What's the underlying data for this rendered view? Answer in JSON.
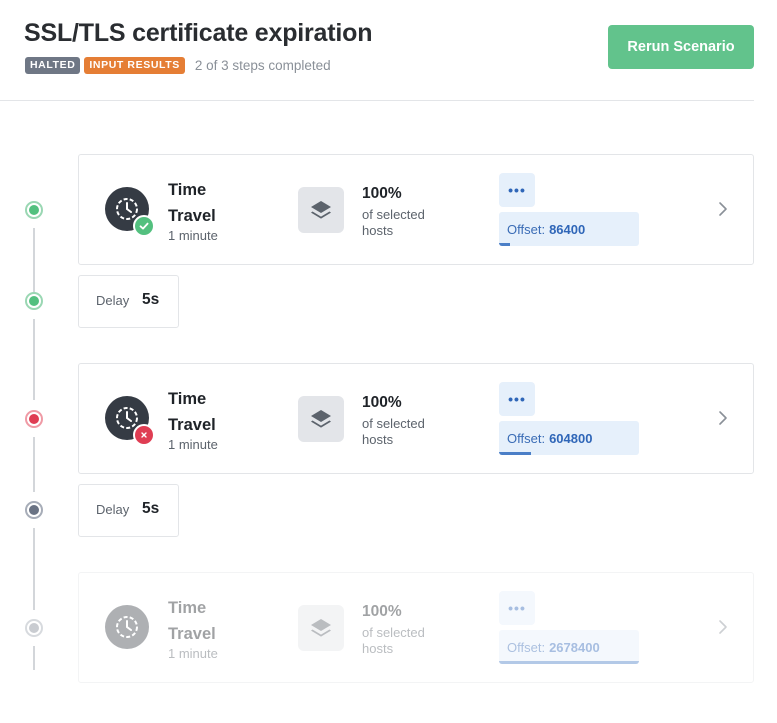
{
  "header": {
    "title": "SSL/TLS certificate expiration",
    "badges": [
      "HALTED",
      "INPUT RESULTS"
    ],
    "progress_text": "2 of 3 steps completed",
    "rerun_label": "Rerun Scenario"
  },
  "colors": {
    "accent_green": "#62c38c",
    "halted_badge": "#6f7785",
    "input_badge": "#e57e35",
    "success": "#53c07f",
    "failure": "#df3d53",
    "offset_link": "#2f66b8"
  },
  "steps": [
    {
      "name": "Time Travel",
      "duration": "1 minute",
      "status": "success",
      "status_icon": "check-icon",
      "targets_percent": "100%",
      "targets_label": "of selected hosts",
      "more_label": "•••",
      "offset_label": "Offset:",
      "offset_value": "86400",
      "progress_fraction": 0.08
    },
    {
      "name": "Time Travel",
      "duration": "1 minute",
      "status": "failed",
      "status_icon": "x-icon",
      "targets_percent": "100%",
      "targets_label": "of selected hosts",
      "more_label": "•••",
      "offset_label": "Offset:",
      "offset_value": "604800",
      "progress_fraction": 0.23
    },
    {
      "name": "Time Travel",
      "duration": "1 minute",
      "status": "not-run",
      "status_icon": "",
      "targets_percent": "100%",
      "targets_label": "of selected hosts",
      "more_label": "•••",
      "offset_label": "Offset:",
      "offset_value": "2678400",
      "progress_fraction": 1.0
    }
  ],
  "delays": [
    {
      "label": "Delay",
      "value": "5s"
    },
    {
      "label": "Delay",
      "value": "5s"
    }
  ]
}
